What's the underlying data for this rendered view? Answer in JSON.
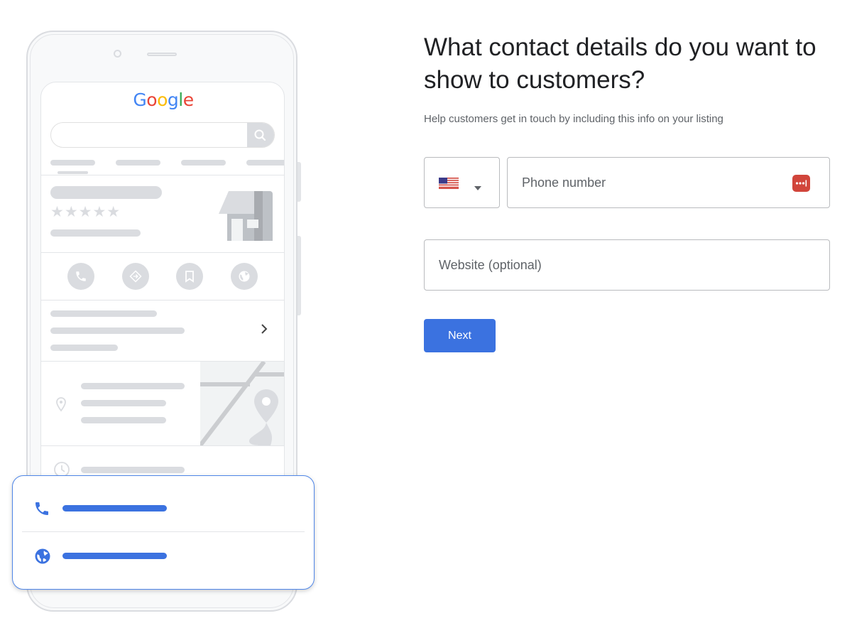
{
  "page": {
    "title": "What contact details do you want to show to customers?",
    "subtitle": "Help customers get in touch by including this info on your listing"
  },
  "form": {
    "country_selector": {
      "selected": "United States",
      "flag_icon": "us-flag-icon",
      "dropdown_icon": "caret-down-icon"
    },
    "phone": {
      "value": "",
      "placeholder": "Phone number",
      "password_manager_icon": "password-manager-icon"
    },
    "website": {
      "value": "",
      "placeholder": "Website (optional)"
    },
    "next_label": "Next"
  },
  "illustration": {
    "logo_letters": [
      {
        "ch": "G",
        "color": "#4285f4"
      },
      {
        "ch": "o",
        "color": "#ea4335"
      },
      {
        "ch": "o",
        "color": "#fbbc05"
      },
      {
        "ch": "g",
        "color": "#4285f4"
      },
      {
        "ch": "l",
        "color": "#34a853"
      },
      {
        "ch": "e",
        "color": "#ea4335"
      }
    ],
    "rating_stars": "★★★★★",
    "action_icons": [
      "phone-icon",
      "directions-icon",
      "bookmark-icon",
      "globe-icon"
    ],
    "card_items": [
      "phone-icon",
      "globe-icon"
    ]
  },
  "colors": {
    "accent": "#3b72e0",
    "placeholder_gray": "#dadce0",
    "text": "#202124",
    "subtext": "#5f6368",
    "password_icon": "#d1453b"
  }
}
